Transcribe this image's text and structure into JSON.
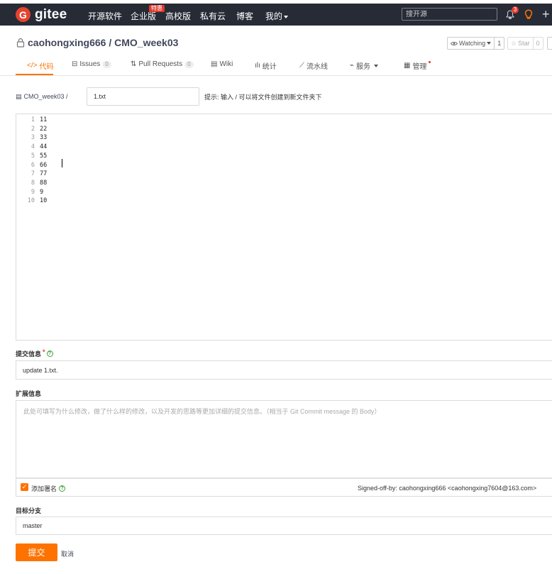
{
  "nav": {
    "logo_letter": "G",
    "brand": "gitee",
    "links": [
      "开源软件",
      "企业版",
      "高校版",
      "私有云",
      "博客",
      "我的"
    ],
    "enterprise_badge": "特惠",
    "search_placeholder": "搜开源",
    "notification_count": "3",
    "colors": {
      "bg": "#262b36",
      "brand": "#e5432f"
    }
  },
  "repo": {
    "title": "caohongxing666 / CMO_week03",
    "watch_label": "Watching",
    "watch_count": "1",
    "star_label": "Star",
    "star_count": "0"
  },
  "tabs": [
    {
      "icon": "code-icon",
      "label": "代码",
      "active": true
    },
    {
      "icon": "issues-icon",
      "label": "Issues",
      "count": "0"
    },
    {
      "icon": "pull-request-icon",
      "label": "Pull Requests",
      "count": "0"
    },
    {
      "icon": "wiki-icon",
      "label": "Wiki"
    },
    {
      "icon": "stats-icon",
      "label": "统计"
    },
    {
      "icon": "pipeline-icon",
      "label": "流水线"
    },
    {
      "icon": "service-icon",
      "label": "服务"
    },
    {
      "icon": "manage-icon",
      "label": "管理"
    }
  ],
  "editor": {
    "path_root": "CMO_week03 /",
    "filename": "1.txt",
    "path_hint": "提示: 输入 / 可以将文件创建到新文件夹下",
    "lines": [
      {
        "n": "1",
        "text": "11"
      },
      {
        "n": "2",
        "text": "22"
      },
      {
        "n": "3",
        "text": "33"
      },
      {
        "n": "4",
        "text": "44"
      },
      {
        "n": "5",
        "text": "55"
      },
      {
        "n": "6",
        "text": "66"
      },
      {
        "n": "7",
        "text": "77"
      },
      {
        "n": "8",
        "text": "88"
      },
      {
        "n": "9",
        "text": "9"
      },
      {
        "n": "10",
        "text": "10"
      }
    ]
  },
  "commit": {
    "message_label": "提交信息",
    "required_mark": "*",
    "message_value": "update 1.txt.",
    "ext_label": "扩展信息",
    "ext_placeholder": "此处可填写为什么修改，做了什么样的修改，以及开发的思路等更加详细的提交信息。（相当于 Git Commit message 的 Body）",
    "signoff_label": "添加署名",
    "signoff_text": "Signed-off-by: caohongxing666 <caohongxing7604@163.com>",
    "branch_label": "目标分支",
    "branch_value": "master",
    "submit_label": "提交",
    "cancel_label": "取消",
    "accent": "#fe7300"
  }
}
